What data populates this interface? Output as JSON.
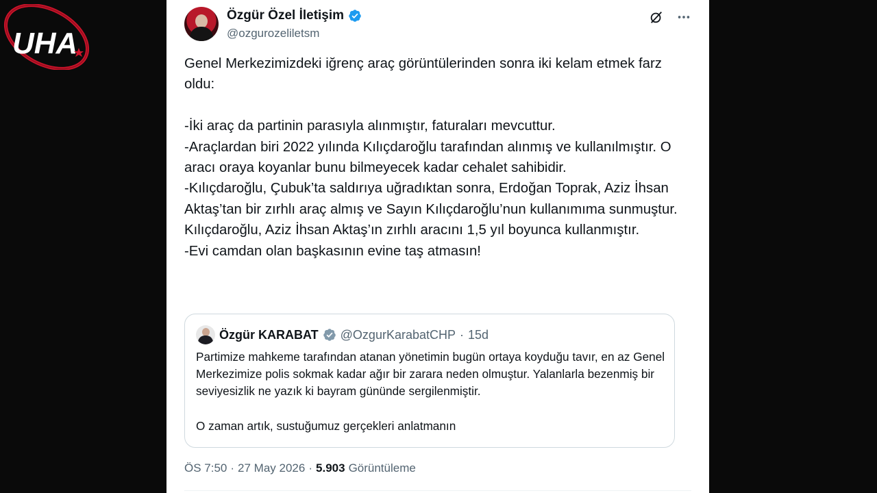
{
  "watermark": {
    "text": "UHA"
  },
  "tweet": {
    "author": {
      "name": "Özgür Özel İletişim",
      "handle": "@ozgurozeliletsm",
      "verified_icon": "verified-badge-icon"
    },
    "top_icons": [
      "grok-icon",
      "more-icon"
    ],
    "text": "Genel Merkezimizdeki iğrenç araç görüntülerinden sonra iki kelam etmek farz oldu:\n\n-İki araç da partinin parasıyla alınmıştır, faturaları mevcuttur.\n-Araçlardan biri 2022 yılında Kılıçdaroğlu tarafından alınmış ve kullanılmıştır. O aracı oraya koyanlar bunu bilmeyecek kadar cehalet sahibidir.\n-Kılıçdaroğlu, Çubuk’ta saldırıya uğradıktan sonra, Erdoğan Toprak, Aziz İhsan Aktaş’tan bir zırhlı araç almış ve Sayın Kılıçdaroğlu’nun kullanımıma sunmuştur. Kılıçdaroğlu, Aziz İhsan Aktaş’ın zırhlı aracını 1,5 yıl boyunca kullanmıştır.\n-Evi camdan olan başkasının evine taş atmasın!",
    "quoted": {
      "name": "Özgür KARABAT",
      "handle": "@OzgurKarabatCHP",
      "separator": "·",
      "age": "15d",
      "paragraph1": "Partimize mahkeme tarafından atanan yönetimin bugün ortaya koyduğu tavır, en az Genel Merkezimize polis sokmak kadar ağır bir zarara neden olmuştur. Yalanlarla bezenmiş bir seviyesizlik ne yazık ki bayram gününde sergilenmiştir.",
      "paragraph2": "O zaman artık, sustuğumuz gerçekleri anlatmanın"
    },
    "meta": {
      "time": "ÖS 7:50",
      "separator": "·",
      "date": "27 May 2026",
      "views_count": "5.903",
      "views_label": "Görüntüleme"
    }
  },
  "colors": {
    "verified_blue": "#1d9bf0",
    "quoted_verified_gray": "#829aab",
    "watermark_red": "#d0142c"
  }
}
